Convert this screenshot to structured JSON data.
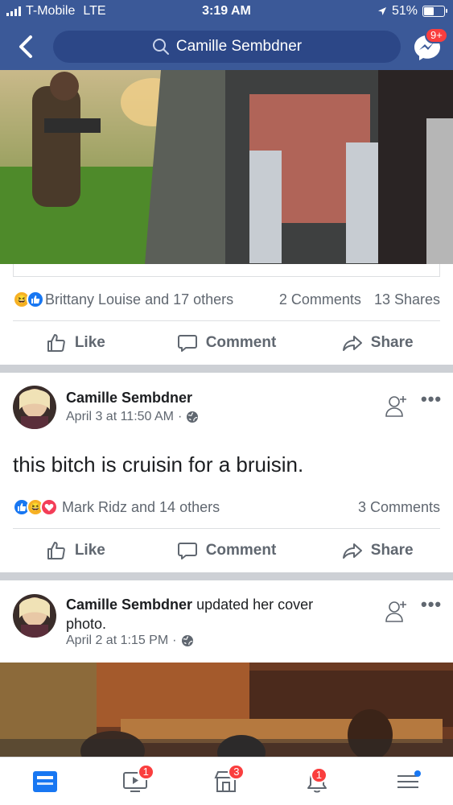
{
  "status_bar": {
    "carrier": "T-Mobile",
    "network": "LTE",
    "time": "3:19 AM",
    "battery": "51%",
    "battery_level": 0.51
  },
  "header": {
    "search_text": "Camille Sembdner",
    "messenger_badge": "9+"
  },
  "post1": {
    "reactions_text": "Brittany Louise and 17 others",
    "comments": "2 Comments",
    "shares": "13 Shares"
  },
  "actions": {
    "like": "Like",
    "comment": "Comment",
    "share": "Share"
  },
  "post2": {
    "author": "Camille Sembdner",
    "timestamp": "April 3 at 11:50 AM",
    "separator": "·",
    "text": "this bitch is cruisin for a bruisin.",
    "reactions_text": "Mark Ridz and 14 others",
    "comments": "3 Comments"
  },
  "post3": {
    "author": "Camille Sembdner",
    "action_text": "updated her cover",
    "action_text_2": "photo.",
    "timestamp": "April 2 at 1:15 PM",
    "separator": "·"
  },
  "tabbar": {
    "video_badge": "1",
    "marketplace_badge": "3",
    "notifications_badge": "1"
  },
  "colors": {
    "brand": "#3b5998",
    "badge": "#fa3e3e",
    "muted_text": "#606770"
  }
}
